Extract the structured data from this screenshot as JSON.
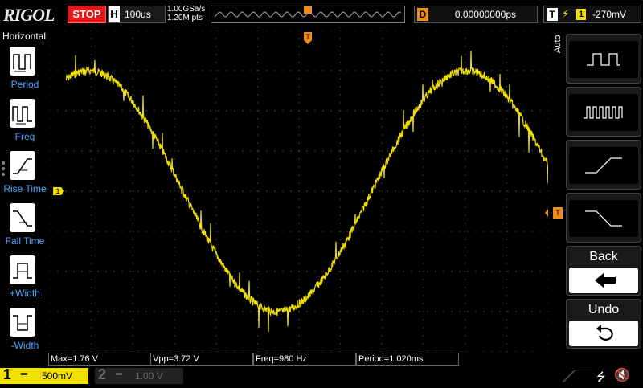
{
  "brand": "RIGOL",
  "status": "STOP",
  "horizontal": {
    "label": "H",
    "timebase": "100us",
    "sample_rate": "1.00GSa/s",
    "points": "1.20M pts"
  },
  "trigger_marker": "T",
  "delay": {
    "label": "D",
    "value": "0.00000000ps"
  },
  "trigger": {
    "label": "T",
    "channel": "1",
    "level": "-270mV"
  },
  "left_menu": {
    "title": "Horizontal",
    "items": [
      {
        "label": "Period",
        "icon": "period-icon"
      },
      {
        "label": "Freq",
        "icon": "frequency-icon"
      },
      {
        "label": "Rise Time",
        "icon": "rise-time-icon"
      },
      {
        "label": "Fall Time",
        "icon": "fall-time-icon"
      },
      {
        "label": "+Width",
        "icon": "positive-width-icon"
      },
      {
        "label": "-Width",
        "icon": "negative-width-icon"
      }
    ]
  },
  "right_menu": {
    "mode": "Auto",
    "back_label": "Back",
    "undo_label": "Undo"
  },
  "measurements": [
    "Max=1.76 V",
    "Vpp=3.72 V",
    "Freq=980 Hz",
    "Period=1.020ms"
  ],
  "channels": [
    {
      "number": "1",
      "scale": "500mV",
      "color": "#f0e000"
    },
    {
      "number": "2",
      "scale": "1.00 V",
      "color": "#3a7bd5"
    }
  ],
  "waveform": {
    "color": "#f0e000",
    "trigger_level_marker": "T",
    "channel_marker": "1"
  }
}
